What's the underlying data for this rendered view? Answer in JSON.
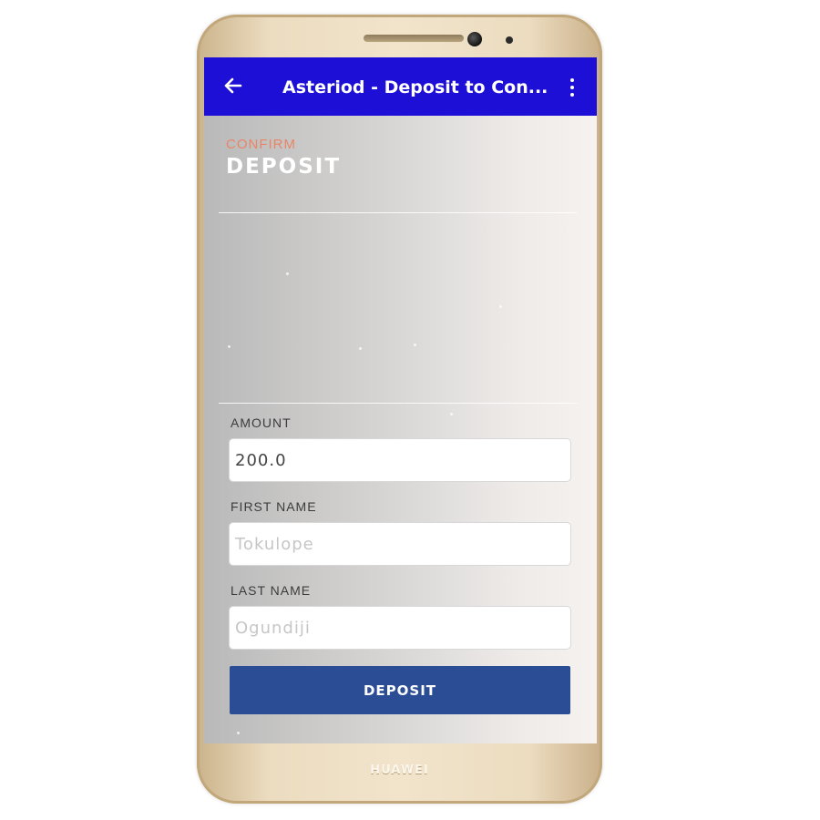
{
  "device": {
    "brand": "HUAWEI"
  },
  "appbar": {
    "back_icon": "arrow-left-icon",
    "title": "Asteriod - Deposit to Con...",
    "menu_icon": "more-vertical-icon"
  },
  "header": {
    "confirm_label": "CONFIRM",
    "title": "DEPOSIT"
  },
  "form": {
    "amount": {
      "label": "AMOUNT",
      "value": "200.0"
    },
    "first_name": {
      "label": "FIRST NAME",
      "placeholder": "Tokulope"
    },
    "last_name": {
      "label": "LAST NAME",
      "placeholder": "Ogundiji"
    },
    "submit_label": "DEPOSIT"
  },
  "colors": {
    "appbar": "#1d0fd6",
    "accent": "#e98567",
    "button": "#2b4d95"
  }
}
